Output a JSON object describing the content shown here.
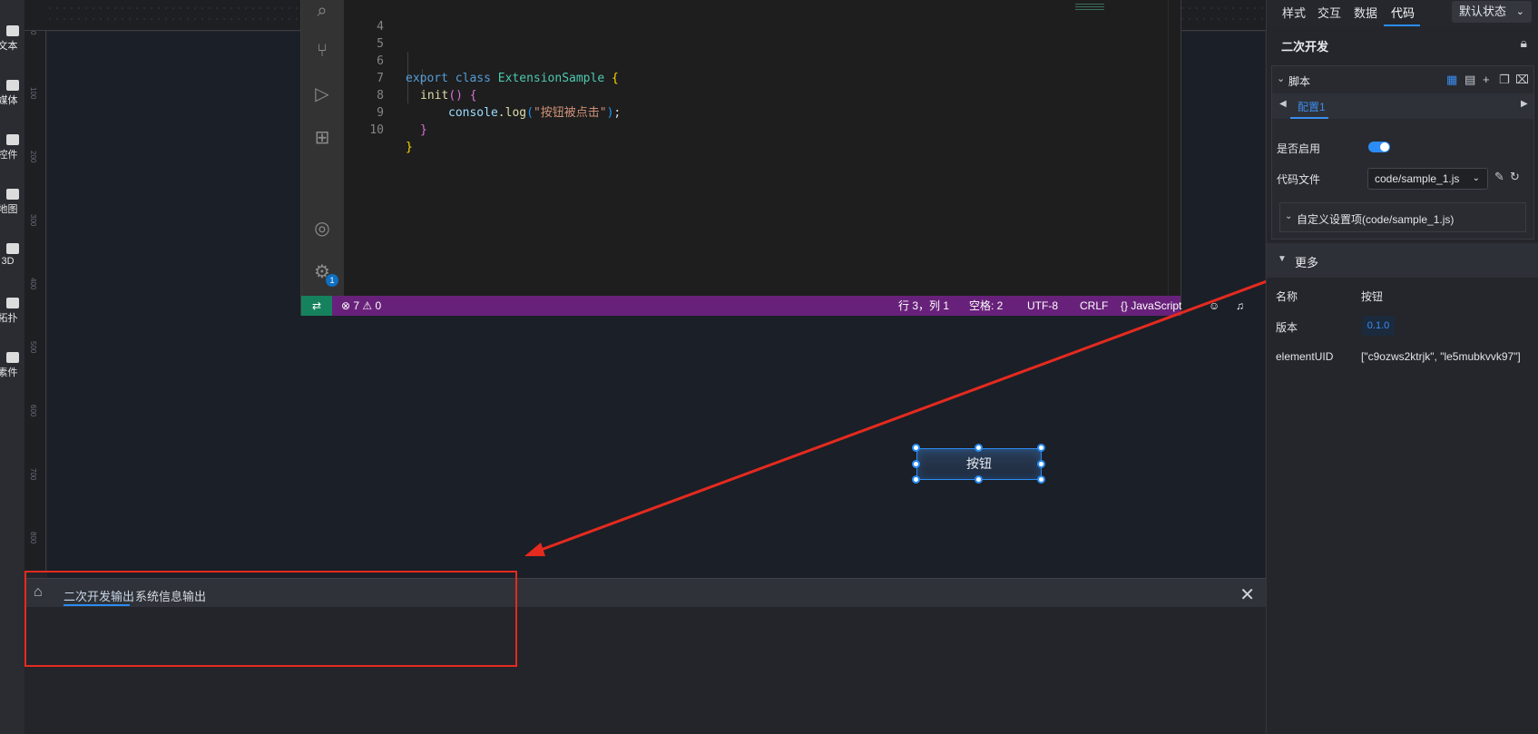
{
  "left_toolbar": {
    "items": [
      {
        "label": "文本",
        "icon": "text-icon"
      },
      {
        "label": "媒体",
        "icon": "camera-icon"
      },
      {
        "label": "控件",
        "icon": "control-icon"
      },
      {
        "label": "地图",
        "icon": "map-icon"
      },
      {
        "label": "3D",
        "icon": "cube-icon"
      },
      {
        "label": "拓扑",
        "icon": "cloud-icon"
      },
      {
        "label": "素件",
        "icon": "shirt-icon"
      }
    ]
  },
  "ruler": {
    "left_ticks": [
      "0",
      "100",
      "200",
      "300",
      "400",
      "500",
      "600",
      "700",
      "800"
    ]
  },
  "editor": {
    "lines": [
      {
        "num": "4",
        "code": ""
      },
      {
        "num": "5",
        "code": ""
      },
      {
        "num": "6",
        "code": "export class ExtensionSample {"
      },
      {
        "num": "7",
        "code": "init() {"
      },
      {
        "num": "8",
        "code": "console.log(\"按钮被点击\");"
      },
      {
        "num": "9",
        "code": "}"
      },
      {
        "num": "10",
        "code": "}"
      }
    ],
    "tokens": {
      "export": "export",
      "class": "class",
      "classname": "ExtensionSample",
      "brace_open": "{",
      "init": "init",
      "parens": "()",
      "console": "console",
      "log": ".log",
      "lp": "(",
      "string": "\"按钮被点击\"",
      "rp": ")",
      "semi": ";",
      "brace_close_inner": "}",
      "brace_close_outer": "}"
    },
    "badge_count": "1",
    "status": {
      "errors": "7",
      "warnings": "0",
      "position": "行 3，列 1",
      "spaces": "空格: 2",
      "encoding": "UTF-8",
      "eol": "CRLF",
      "language": "JavaScript"
    }
  },
  "canvas": {
    "button_label": "按钮"
  },
  "output": {
    "tabs": [
      {
        "label": "二次开发输出",
        "active": true
      },
      {
        "label": "系统信息输出",
        "active": false
      }
    ]
  },
  "right_panel": {
    "tabs": [
      {
        "label": "样式",
        "active": false
      },
      {
        "label": "交互",
        "active": false
      },
      {
        "label": "数据",
        "active": false
      },
      {
        "label": "代码",
        "active": true
      }
    ],
    "state_select": "默认状态",
    "section_title": "二次开发",
    "script": {
      "title": "脚本",
      "config_tab": "配置1",
      "enable_label": "是否启用",
      "enabled": true,
      "file_label": "代码文件",
      "file_value": "code/sample_1.js",
      "custom_settings": "自定义设置项(code/sample_1.js)"
    },
    "more": {
      "title": "更多",
      "name_label": "名称",
      "name_value": "按钮",
      "version_label": "版本",
      "version_value": "0.1.0",
      "uid_label": "elementUID",
      "uid_value": "[\"c9ozws2ktrjk\", \"le5mubkvvk97\"]"
    }
  },
  "colors": {
    "accent": "#2b8cf6",
    "statusbar": "#68217a",
    "annotation": "#e52a1f"
  }
}
